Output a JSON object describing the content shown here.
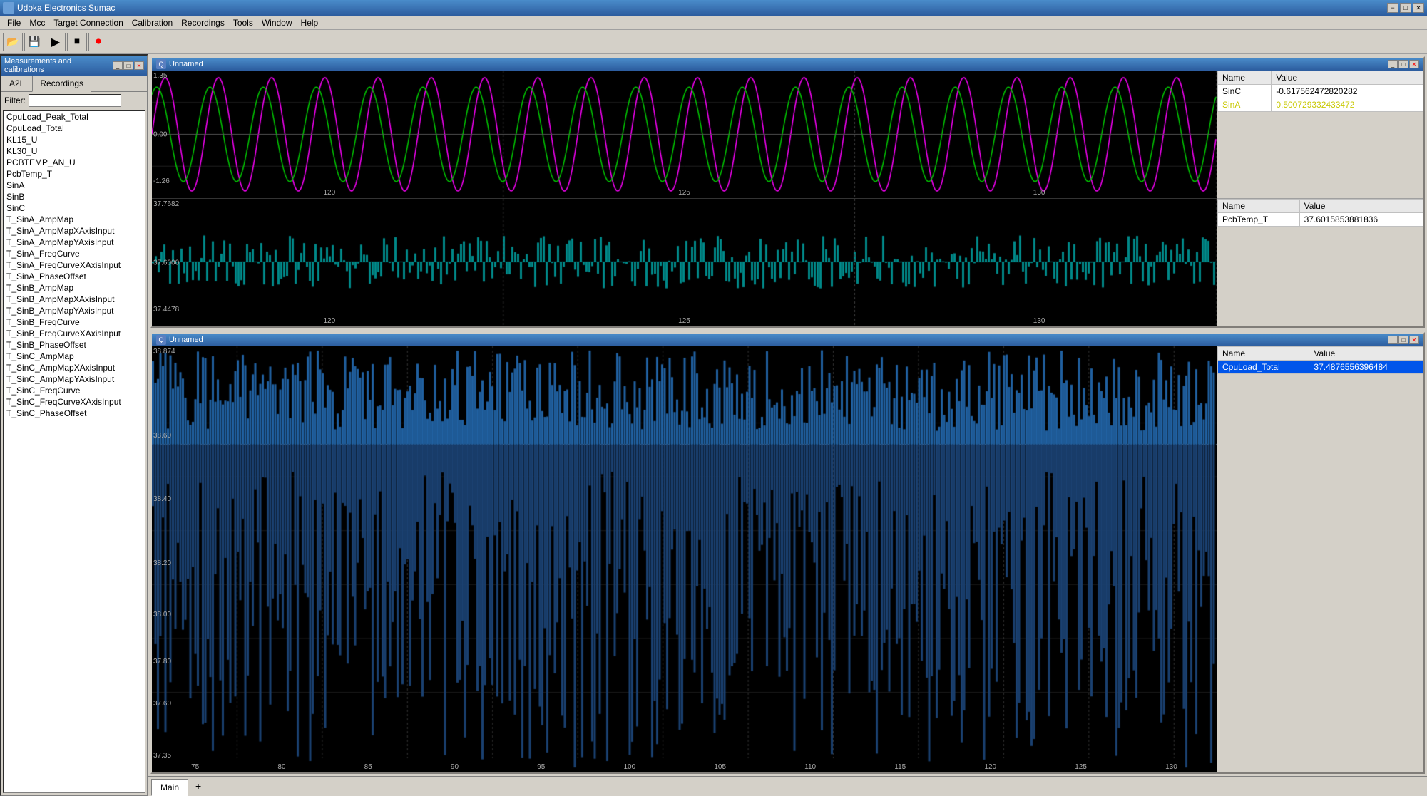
{
  "app": {
    "title": "Udoka Electronics Sumac",
    "icon": "Q"
  },
  "titlebar": {
    "minimize": "−",
    "maximize": "□",
    "close": "✕"
  },
  "menubar": {
    "items": [
      "File",
      "Mcc",
      "Target Connection",
      "Calibration",
      "Recordings",
      "Tools",
      "Window",
      "Help"
    ]
  },
  "toolbar": {
    "buttons": [
      "📂",
      "💾",
      "▶",
      "⏹",
      "⏺"
    ]
  },
  "leftpanel": {
    "title": "Measurements and calibrations",
    "tabs": [
      "A2L",
      "Recordings"
    ],
    "active_tab": "Recordings",
    "filter_label": "Filter:",
    "filter_placeholder": "",
    "items": [
      "CpuLoad_Peak_Total",
      "CpuLoad_Total",
      "KL15_U",
      "KL30_U",
      "PCBTEMP_AN_U",
      "PcbTemp_T",
      "SinA",
      "SinB",
      "SinC",
      "T_SinA_AmpMap",
      "T_SinA_AmpMapXAxisInput",
      "T_SinA_AmpMapYAxisInput",
      "T_SinA_FreqCurve",
      "T_SinA_FreqCurveXAxisInput",
      "T_SinA_PhaseOffset",
      "T_SinB_AmpMap",
      "T_SinB_AmpMapXAxisInput",
      "T_SinB_AmpMapYAxisInput",
      "T_SinB_FreqCurve",
      "T_SinB_FreqCurveXAxisInput",
      "T_SinB_PhaseOffset",
      "T_SinC_AmpMap",
      "T_SinC_AmpMapXAxisInput",
      "T_SinC_AmpMapYAxisInput",
      "T_SinC_FreqCurve",
      "T_SinC_FreqCurveXAxisInput",
      "T_SinC_PhaseOffset"
    ]
  },
  "chart_upper": {
    "title": "Unnamed",
    "icon": "Q",
    "sub_charts": [
      {
        "id": "sin_chart",
        "y_max": "1.35",
        "y_zero": "0.00",
        "y_min": "-1.26",
        "x_labels": [
          "120",
          "125",
          "130"
        ],
        "series": [
          {
            "name": "SinC",
            "color": "#ff00ff"
          },
          {
            "name": "SinA",
            "color": "#00cc00"
          }
        ]
      },
      {
        "id": "pcbtemp_chart",
        "y_max": "37.7682",
        "y_mid": "37.6000",
        "y_min": "37.4478",
        "x_labels": [
          "120",
          "125",
          "130"
        ]
      }
    ],
    "data_table_sin": {
      "headers": [
        "Name",
        "Value"
      ],
      "rows": [
        {
          "name": "SinC",
          "value": "-0.617562472820282",
          "selected": false,
          "highlighted": false
        },
        {
          "name": "SinA",
          "value": "0.500729332433472",
          "selected": false,
          "highlighted": true
        }
      ]
    },
    "data_table_pcb": {
      "headers": [
        "Name",
        "Value"
      ],
      "rows": [
        {
          "name": "PcbTemp_T",
          "value": "37.6015853881836",
          "selected": false
        }
      ]
    }
  },
  "chart_lower": {
    "title": "Unnamed",
    "icon": "Q",
    "y_max": "38.874",
    "y_vals": [
      "38.60",
      "38.40",
      "38.20",
      "38.00",
      "37.80",
      "37.60",
      "37.35"
    ],
    "x_labels": [
      "75",
      "80",
      "85",
      "90",
      "95",
      "100",
      "105",
      "110",
      "115",
      "120",
      "125",
      "130"
    ],
    "data_table": {
      "headers": [
        "Name",
        "Value"
      ],
      "rows": [
        {
          "name": "CpuLoad_Total",
          "value": "37.4876556396484",
          "selected": true
        }
      ]
    }
  },
  "bottom_tabs": {
    "tabs": [
      "Main"
    ],
    "active": "Main",
    "add_btn": "+"
  }
}
